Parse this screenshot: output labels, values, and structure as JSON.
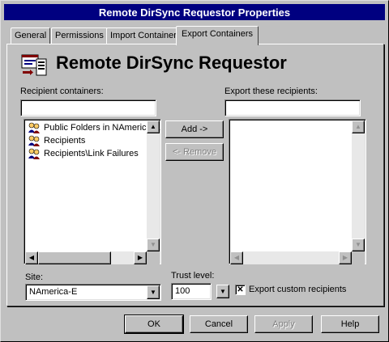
{
  "window": {
    "title": "Remote DirSync Requestor Properties"
  },
  "tabs": [
    {
      "label": "General"
    },
    {
      "label": "Permissions"
    },
    {
      "label": "Import Container"
    },
    {
      "label": "Export Containers"
    }
  ],
  "heading": {
    "title": "Remote DirSync Requestor",
    "icon": "directory-sync-icon"
  },
  "recipient_containers": {
    "label": "Recipient containers:",
    "filter_value": "",
    "items": [
      {
        "label": "Public Folders in NAmerica-E",
        "icon": "recipients-container-icon"
      },
      {
        "label": "Recipients",
        "icon": "recipients-container-icon"
      },
      {
        "label": "Recipients\\Link Failures",
        "icon": "recipients-container-icon"
      }
    ]
  },
  "export_recipients": {
    "label": "Export these recipients:",
    "filter_value": "",
    "items": []
  },
  "actions": {
    "add_label": "Add ->",
    "remove_label": "<- Remove"
  },
  "site": {
    "label": "Site:",
    "value": "NAmerica-E"
  },
  "trust_level": {
    "label": "Trust level:",
    "value": "100"
  },
  "export_custom": {
    "label": "Export custom recipients",
    "checked": true
  },
  "footer": {
    "ok": "OK",
    "cancel": "Cancel",
    "apply": "Apply",
    "help": "Help"
  }
}
